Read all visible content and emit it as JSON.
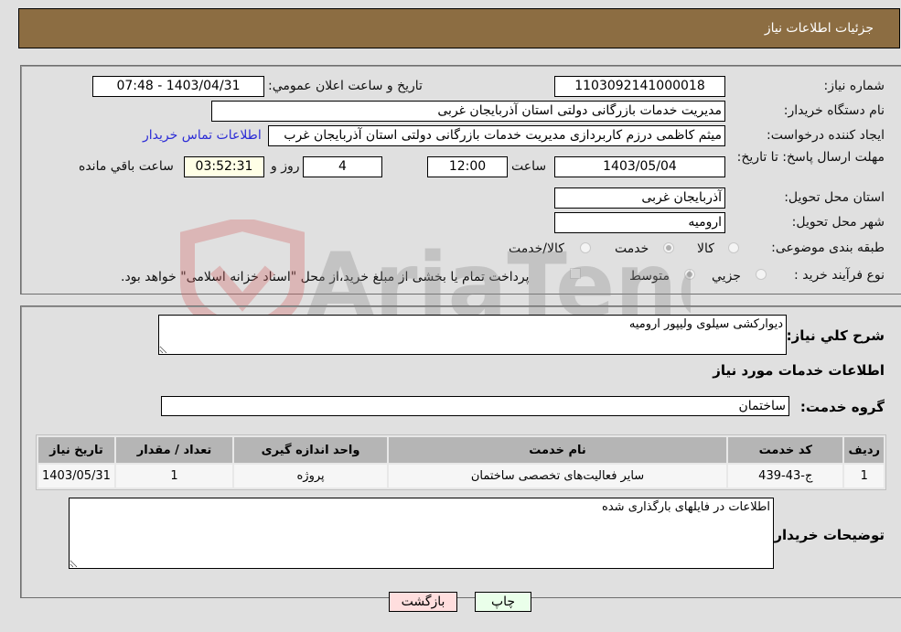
{
  "header": {
    "title": "جزئیات اطلاعات نیاز"
  },
  "details": {
    "need_number_label": "شماره نیاز:",
    "need_number": "1103092141000018",
    "announce_label": "تاريخ و ساعت اعلان عمومي:",
    "announce_value": "1403/04/31 - 07:48",
    "buyer_org_label": "نام دستگاه خریدار:",
    "buyer_org": "مدیریت خدمات بازرگانی دولتی استان آذربایجان غربی",
    "creator_label": "ایجاد کننده درخواست:",
    "creator": "میثم کاظمی درزم کاربردازی مدیریت خدمات بازرگانی دولتی استان آذربایجان غرب",
    "contact_link": "اطلاعات تماس خریدار",
    "deadline_label": "مهلت ارسال پاسخ: تا تاریخ:",
    "deadline_date": "1403/05/04",
    "time_label": "ساعت",
    "deadline_time": "12:00",
    "days_value": "4",
    "days_label": "روز و",
    "remaining_time": "03:52:31",
    "remaining_label": "ساعت باقي مانده",
    "province_label": "استان محل تحویل:",
    "province": "آذربایجان غربی",
    "city_label": "شهر محل تحویل:",
    "city": "ارومیه",
    "category_label": "طبقه بندی موضوعی:",
    "category_options": [
      {
        "label": "کالا",
        "checked": false
      },
      {
        "label": "خدمت",
        "checked": true
      },
      {
        "label": "کالا/خدمت",
        "checked": false
      }
    ],
    "process_label": "نوع فرآیند خرید :",
    "process_options": [
      {
        "label": "جزیي",
        "checked": false
      },
      {
        "label": "متوسط",
        "checked": true
      }
    ],
    "treasury_note": "پرداخت تمام یا بخشی از مبلغ خرید،از محل \"اسناد خزانه اسلامی\" خواهد بود."
  },
  "services": {
    "summary_label": "شرح کلي نياز:",
    "summary": "دیوارکشی سیلوی ولیپور ارومیه",
    "section_title": "اطلاعات خدمات مورد نیاز",
    "group_label": "گروه خدمت:",
    "group": "ساختمان",
    "table": {
      "headers": [
        "ردیف",
        "کد خدمت",
        "نام خدمت",
        "واحد اندازه گیری",
        "تعداد / مقدار",
        "تاریخ نیاز"
      ],
      "rows": [
        [
          "1",
          "ج-43-439",
          "سایر فعالیت‌های تخصصی ساختمان",
          "پروژه",
          "1",
          "1403/05/31"
        ]
      ]
    },
    "buyer_notes_label": "توضیحات خریدار:",
    "buyer_notes": "اطلاعات در فایلهای بارگذاری شده"
  },
  "buttons": {
    "print": "چاپ",
    "back": "بازگشت"
  },
  "watermark": {
    "text": "AriaTender.neT"
  },
  "colors": {
    "header_bg": "#8c6d42",
    "print_bg": "#eaffea",
    "back_bg": "#ffdede",
    "link": "#2b2bd6"
  }
}
